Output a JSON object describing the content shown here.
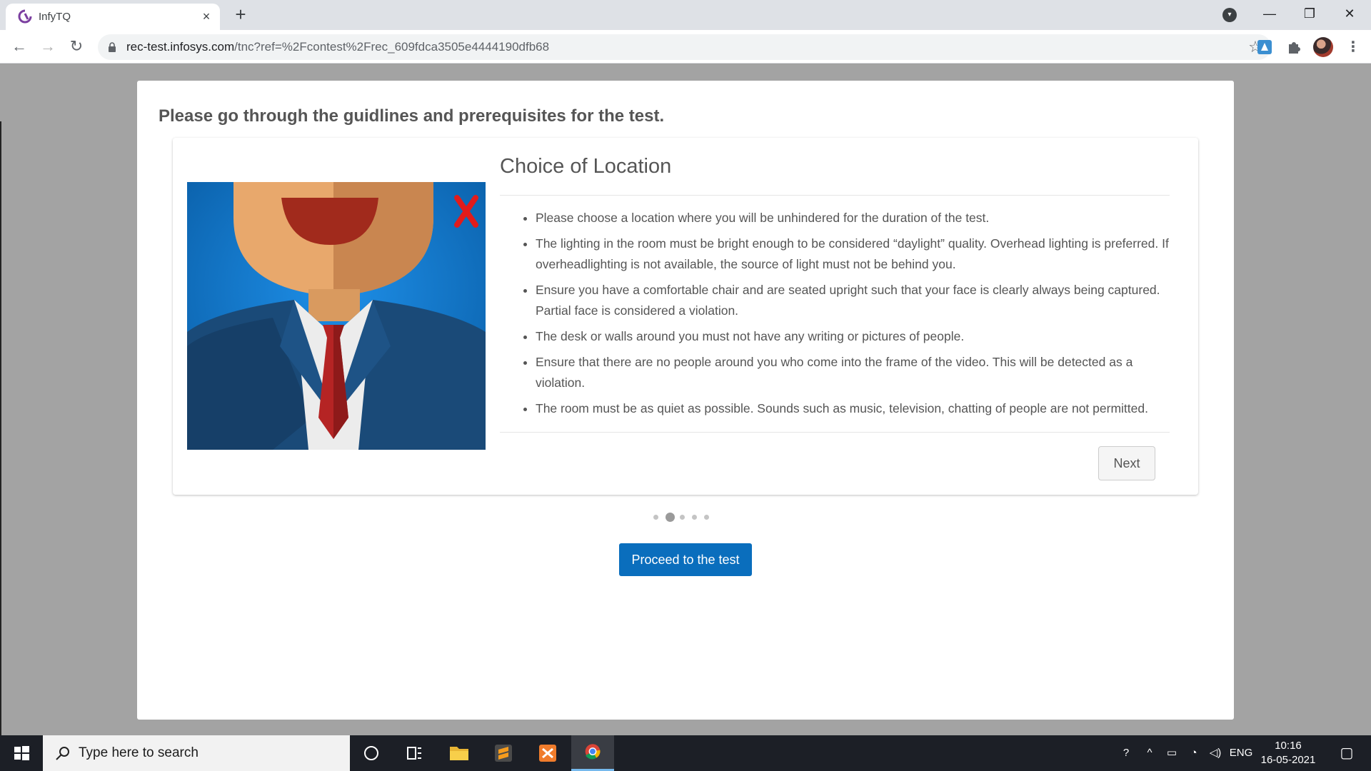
{
  "browser": {
    "tab_title": "InfyTQ",
    "url_host": "rec-test.infosys.com",
    "url_path": "/tnc?ref=%2Fcontest%2Frec_609fdca3505e4444190dfb68"
  },
  "page": {
    "title": "Please go through the guidlines and prerequisites for the test.",
    "card": {
      "heading": "Choice of Location",
      "rules": [
        "Please choose a location where you will be unhindered for the duration of the test.",
        "The lighting in the room must be bright enough to be considered “daylight” quality. Overhead lighting is preferred. If overheadlighting is not available, the source of light must not be behind you.",
        "Ensure you have a comfortable chair and are seated upright such that your face is clearly always being captured. Partial face is considered a violation.",
        "The desk or walls around you must not have any writing or pictures of people.",
        "Ensure that there are no people around you who come into the frame of the video. This will be detected as a violation.",
        "The room must be as quiet as possible. Sounds such as music, television, chatting of people are not permitted."
      ],
      "next_label": "Next"
    },
    "carousel": {
      "total": 5,
      "active_index": 1
    },
    "proceed_label": "Proceed to the test",
    "colors": {
      "primary_button": "#0a6ebd",
      "text": "#555555"
    }
  },
  "taskbar": {
    "search_placeholder": "Type here to search",
    "language": "ENG",
    "time": "10:16",
    "date": "16-05-2021"
  }
}
